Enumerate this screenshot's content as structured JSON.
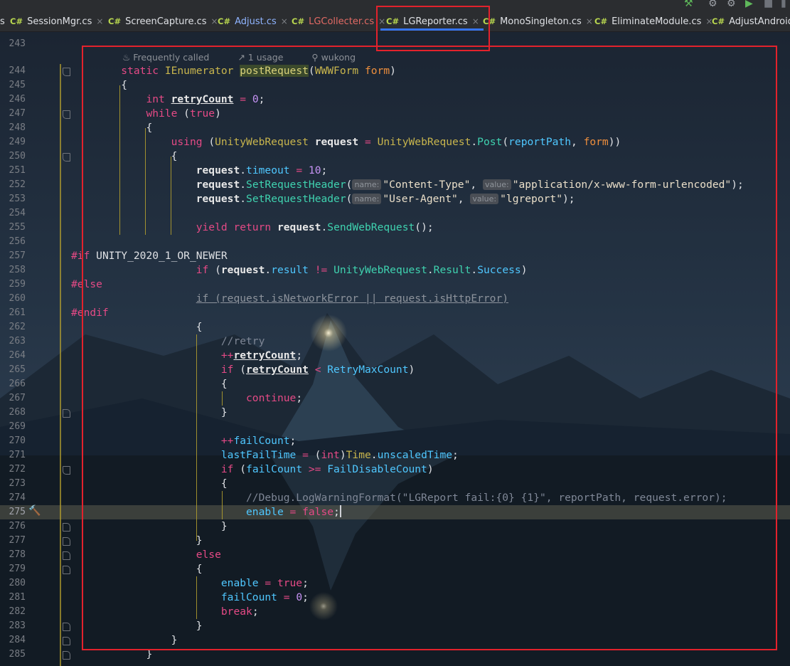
{
  "tabs": [
    {
      "label": "SessionMgr.cs",
      "active": false,
      "closable": true
    },
    {
      "label": "ScreenCapture.cs",
      "active": false,
      "closable": true
    },
    {
      "label": "Adjust.cs",
      "active": false,
      "closable": true,
      "color": "#8fb4ff"
    },
    {
      "label": "LGCollecter.cs",
      "active": false,
      "closable": true,
      "color": "#e26a64"
    },
    {
      "label": "LGReporter.cs",
      "active": true,
      "closable": true
    },
    {
      "label": "MonoSingleton.cs",
      "active": false,
      "closable": true
    },
    {
      "label": "EliminateModule.cs",
      "active": false,
      "closable": true
    },
    {
      "label": "AdjustAndroid.c",
      "active": false,
      "closable": false
    }
  ],
  "tab_prefix": "C#",
  "tab_close": "×",
  "top_left_glyph": "s",
  "hint": {
    "frequently_called": "Frequently called",
    "usages": "1 usage",
    "author": "wukong"
  },
  "line_numbers": [
    "243",
    "244",
    "245",
    "246",
    "247",
    "248",
    "249",
    "250",
    "251",
    "252",
    "253",
    "254",
    "255",
    "256",
    "257",
    "258",
    "259",
    "260",
    "261",
    "262",
    "263",
    "264",
    "265",
    "266",
    "267",
    "268",
    "269",
    "270",
    "271",
    "272",
    "273",
    "274",
    "275",
    "276",
    "277",
    "278",
    "279",
    "280",
    "281",
    "282",
    "283",
    "284",
    "285"
  ],
  "current_line": "275",
  "code": {
    "l244": {
      "static": "static ",
      "ienum": "IEnumerator ",
      "name": "postRequest",
      "open": "(",
      "ptype": "WWWForm ",
      "pname": "form",
      "close": ")"
    },
    "l245": {
      "t": "{"
    },
    "l246": {
      "kw": "int ",
      "id": "retryCount",
      "op": " = ",
      "num": "0",
      "end": ";"
    },
    "l247": {
      "kw": "while ",
      "p1": "(",
      "val": "true",
      "p2": ")"
    },
    "l248": {
      "t": "{"
    },
    "l249": {
      "kw": "using ",
      "p1": "(",
      "ty": "UnityWebRequest ",
      "id": "request",
      "op": " = ",
      "ty2": "UnityWebRequest",
      "dot": ".",
      "fn": "Post",
      "p2": "(",
      "a1": "reportPath",
      ",": ", ",
      "a2": "form",
      "p3": "))"
    },
    "l250": {
      "t": "{"
    },
    "l251": {
      "id": "request",
      "dot": ".",
      "pr": "timeout",
      "op": " = ",
      "num": "10",
      "end": ";"
    },
    "l252": {
      "id": "request",
      "dot": ".",
      "fn": "SetRequestHeader",
      "p1": "(",
      "h1": "name:",
      "s1": "\"Content-Type\"",
      ",": ", ",
      "h2": "value:",
      "s2": "\"application/x-www-form-urlencoded\"",
      "end": ");"
    },
    "l253": {
      "id": "request",
      "dot": ".",
      "fn": "SetRequestHeader",
      "p1": "(",
      "h1": "name:",
      "s1": "\"User-Agent\"",
      ",": ", ",
      "h2": "value:",
      "s2": "\"lgreport\"",
      "end": ");"
    },
    "l255": {
      "kw": "yield return ",
      "id": "request",
      "dot": ".",
      "fn": "SendWebRequest",
      "end": "();"
    },
    "l257": {
      "pp": "#if ",
      "t": "UNITY_2020_1_OR_NEWER"
    },
    "l258": {
      "kw": "if ",
      "p1": "(",
      "id": "request",
      "dot": ".",
      "pr": "result",
      "op": " != ",
      "ty": "UnityWebRequest",
      "dot2": ".",
      "ty2": "Result",
      "dot3": ".",
      "pr2": "Success",
      "p2": ")"
    },
    "l259": {
      "pp": "#else"
    },
    "l260": {
      "t": "if (request.isNetworkError || request.isHttpError)"
    },
    "l261": {
      "pp": "#endif"
    },
    "l262": {
      "t": "{"
    },
    "l263": {
      "cm": "//retry"
    },
    "l264": {
      "op": "++",
      "id": "retryCount",
      "end": ";"
    },
    "l265": {
      "kw": "if ",
      "p1": "(",
      "id": "retryCount",
      "op": " < ",
      "pr": "RetryMaxCount",
      "p2": ")"
    },
    "l266": {
      "t": "{"
    },
    "l267": {
      "kw": "continue",
      "end": ";"
    },
    "l268": {
      "t": "}"
    },
    "l270": {
      "op": "++",
      "pr": "failCount",
      "end": ";"
    },
    "l271": {
      "pr": "lastFailTime",
      "op": " = ",
      "p1": "(",
      "kw": "int",
      "p2": ")",
      "ty": "Time",
      "dot": ".",
      "pr2": "unscaledTime",
      "end": ";"
    },
    "l272": {
      "kw": "if ",
      "p1": "(",
      "pr": "failCount",
      "op": " >= ",
      "pr2": "FailDisableCount",
      "p2": ")"
    },
    "l273": {
      "t": "{"
    },
    "l274": {
      "cm": "//Debug.LogWarningFormat(\"LGReport fail:{0} {1}\", reportPath, request.error);"
    },
    "l275": {
      "pr": "enable",
      "op": " = ",
      "kw": "false",
      "end": ";"
    },
    "l276": {
      "t": "}"
    },
    "l277": {
      "t": "}"
    },
    "l278": {
      "kw": "else"
    },
    "l279": {
      "t": "{"
    },
    "l280": {
      "pr": "enable",
      "op": " = ",
      "kw": "true",
      "end": ";"
    },
    "l281": {
      "pr": "failCount",
      "op": " = ",
      "num": "0",
      "end": ";"
    },
    "l282": {
      "kw": "break",
      "end": ";"
    },
    "l283": {
      "t": "}"
    },
    "l284": {
      "t": "}"
    },
    "l285": {
      "t": "}"
    }
  },
  "colors": {
    "annotation_red": "#e3222c",
    "active_tab_underline": "#3574f0",
    "keyword": "#e54a86",
    "string": "#eadfc9",
    "type": "#c8b54d"
  }
}
